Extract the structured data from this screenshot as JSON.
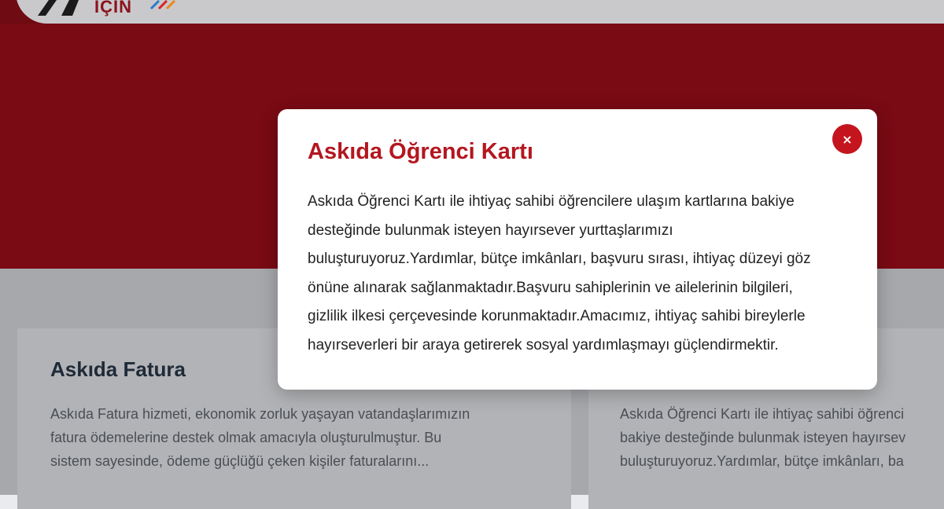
{
  "header": {
    "logo_text": "İÇİN"
  },
  "modal": {
    "title": "Askıda Öğrenci Kartı",
    "close_icon": "×",
    "body_lines": [
      "Askıda Öğrenci Kartı ile ihtiyaç sahibi öğrencilere ulaşım kartlarına bakiye",
      "desteğinde bulunmak isteyen hayırsever yurttaşlarımızı",
      "buluşturuyoruz.Yardımlar, bütçe imkânları, başvuru sırası, ihtiyaç düzeyi göz",
      "önüne alınarak sağlanmaktadır.Başvuru sahiplerinin ve ailelerinin bilgileri,",
      "gizlilik ilkesi çerçevesinde korunmaktadır.Amacımız, ihtiyaç sahibi bireylerle",
      "hayırseverleri bir araya getirerek sosyal yardımlaşmayı güçlendirmektir."
    ]
  },
  "cards": [
    {
      "title": "Askıda Fatura",
      "lines": [
        "Askıda Fatura hizmeti, ekonomik zorluk yaşayan vatandaşlarımızın",
        "fatura ödemelerine destek olmak amacıyla oluşturulmuştur. Bu",
        "sistem sayesinde, ödeme güçlüğü çeken kişiler faturalarını..."
      ]
    },
    {
      "title": "",
      "lines": [
        "Askıda Öğrenci Kartı ile ihtiyaç sahibi öğrenci",
        "bakiye desteğinde bulunmak isteyen hayırsev",
        "buluşturuyoruz.Yardımlar, bütçe imkânları, ba"
      ]
    }
  ],
  "colors": {
    "brand_red": "#c4151f",
    "title_red": "#b4161f"
  }
}
